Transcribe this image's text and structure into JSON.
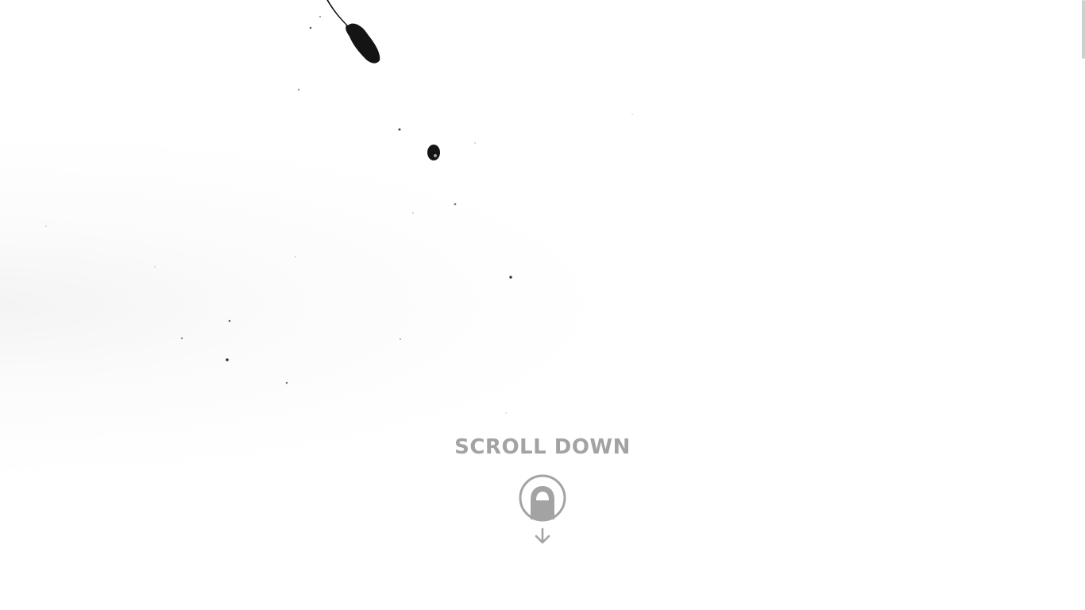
{
  "hero": {
    "scroll_label": "SCROLL DOWN",
    "icons": [
      "ink-splash-art",
      "mouse-icon",
      "down-arrow-icon"
    ],
    "label_color": "#a3a3a3",
    "icon_color": "#a3a3a3",
    "ink_color": "#111111"
  }
}
